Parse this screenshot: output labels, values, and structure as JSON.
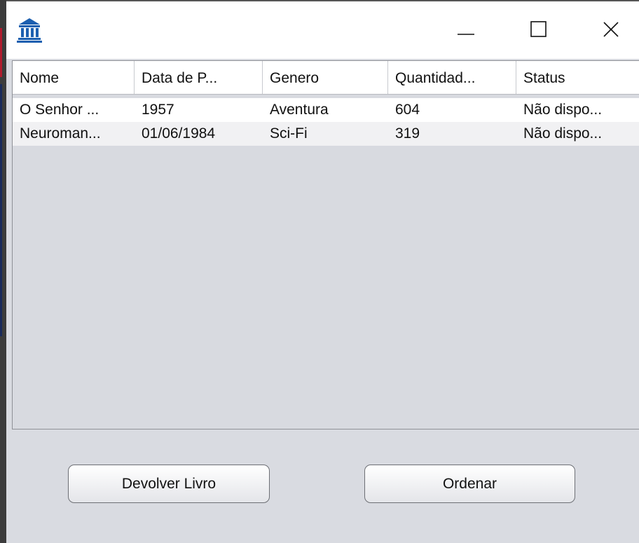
{
  "window": {
    "app_icon": "bank-building-icon",
    "controls": {
      "minimize": "minimize-icon",
      "maximize": "maximize-icon",
      "close": "close-icon"
    }
  },
  "table": {
    "columns": [
      "Nome",
      "Data de P...",
      "Genero",
      "Quantidad...",
      "Status"
    ],
    "rows": [
      [
        "O Senhor ...",
        "1957",
        "Aventura",
        "604",
        "Não dispo..."
      ],
      [
        "Neuroman...",
        "01/06/1984",
        "Sci-Fi",
        "319",
        "Não dispo..."
      ]
    ]
  },
  "buttons": {
    "devolver": "Devolver Livro",
    "ordenar": "Ordenar"
  },
  "colors": {
    "panel_bg": "#d9dbe1",
    "icon_blue": "#1c5fb0",
    "button_border": "#6d6f75"
  }
}
